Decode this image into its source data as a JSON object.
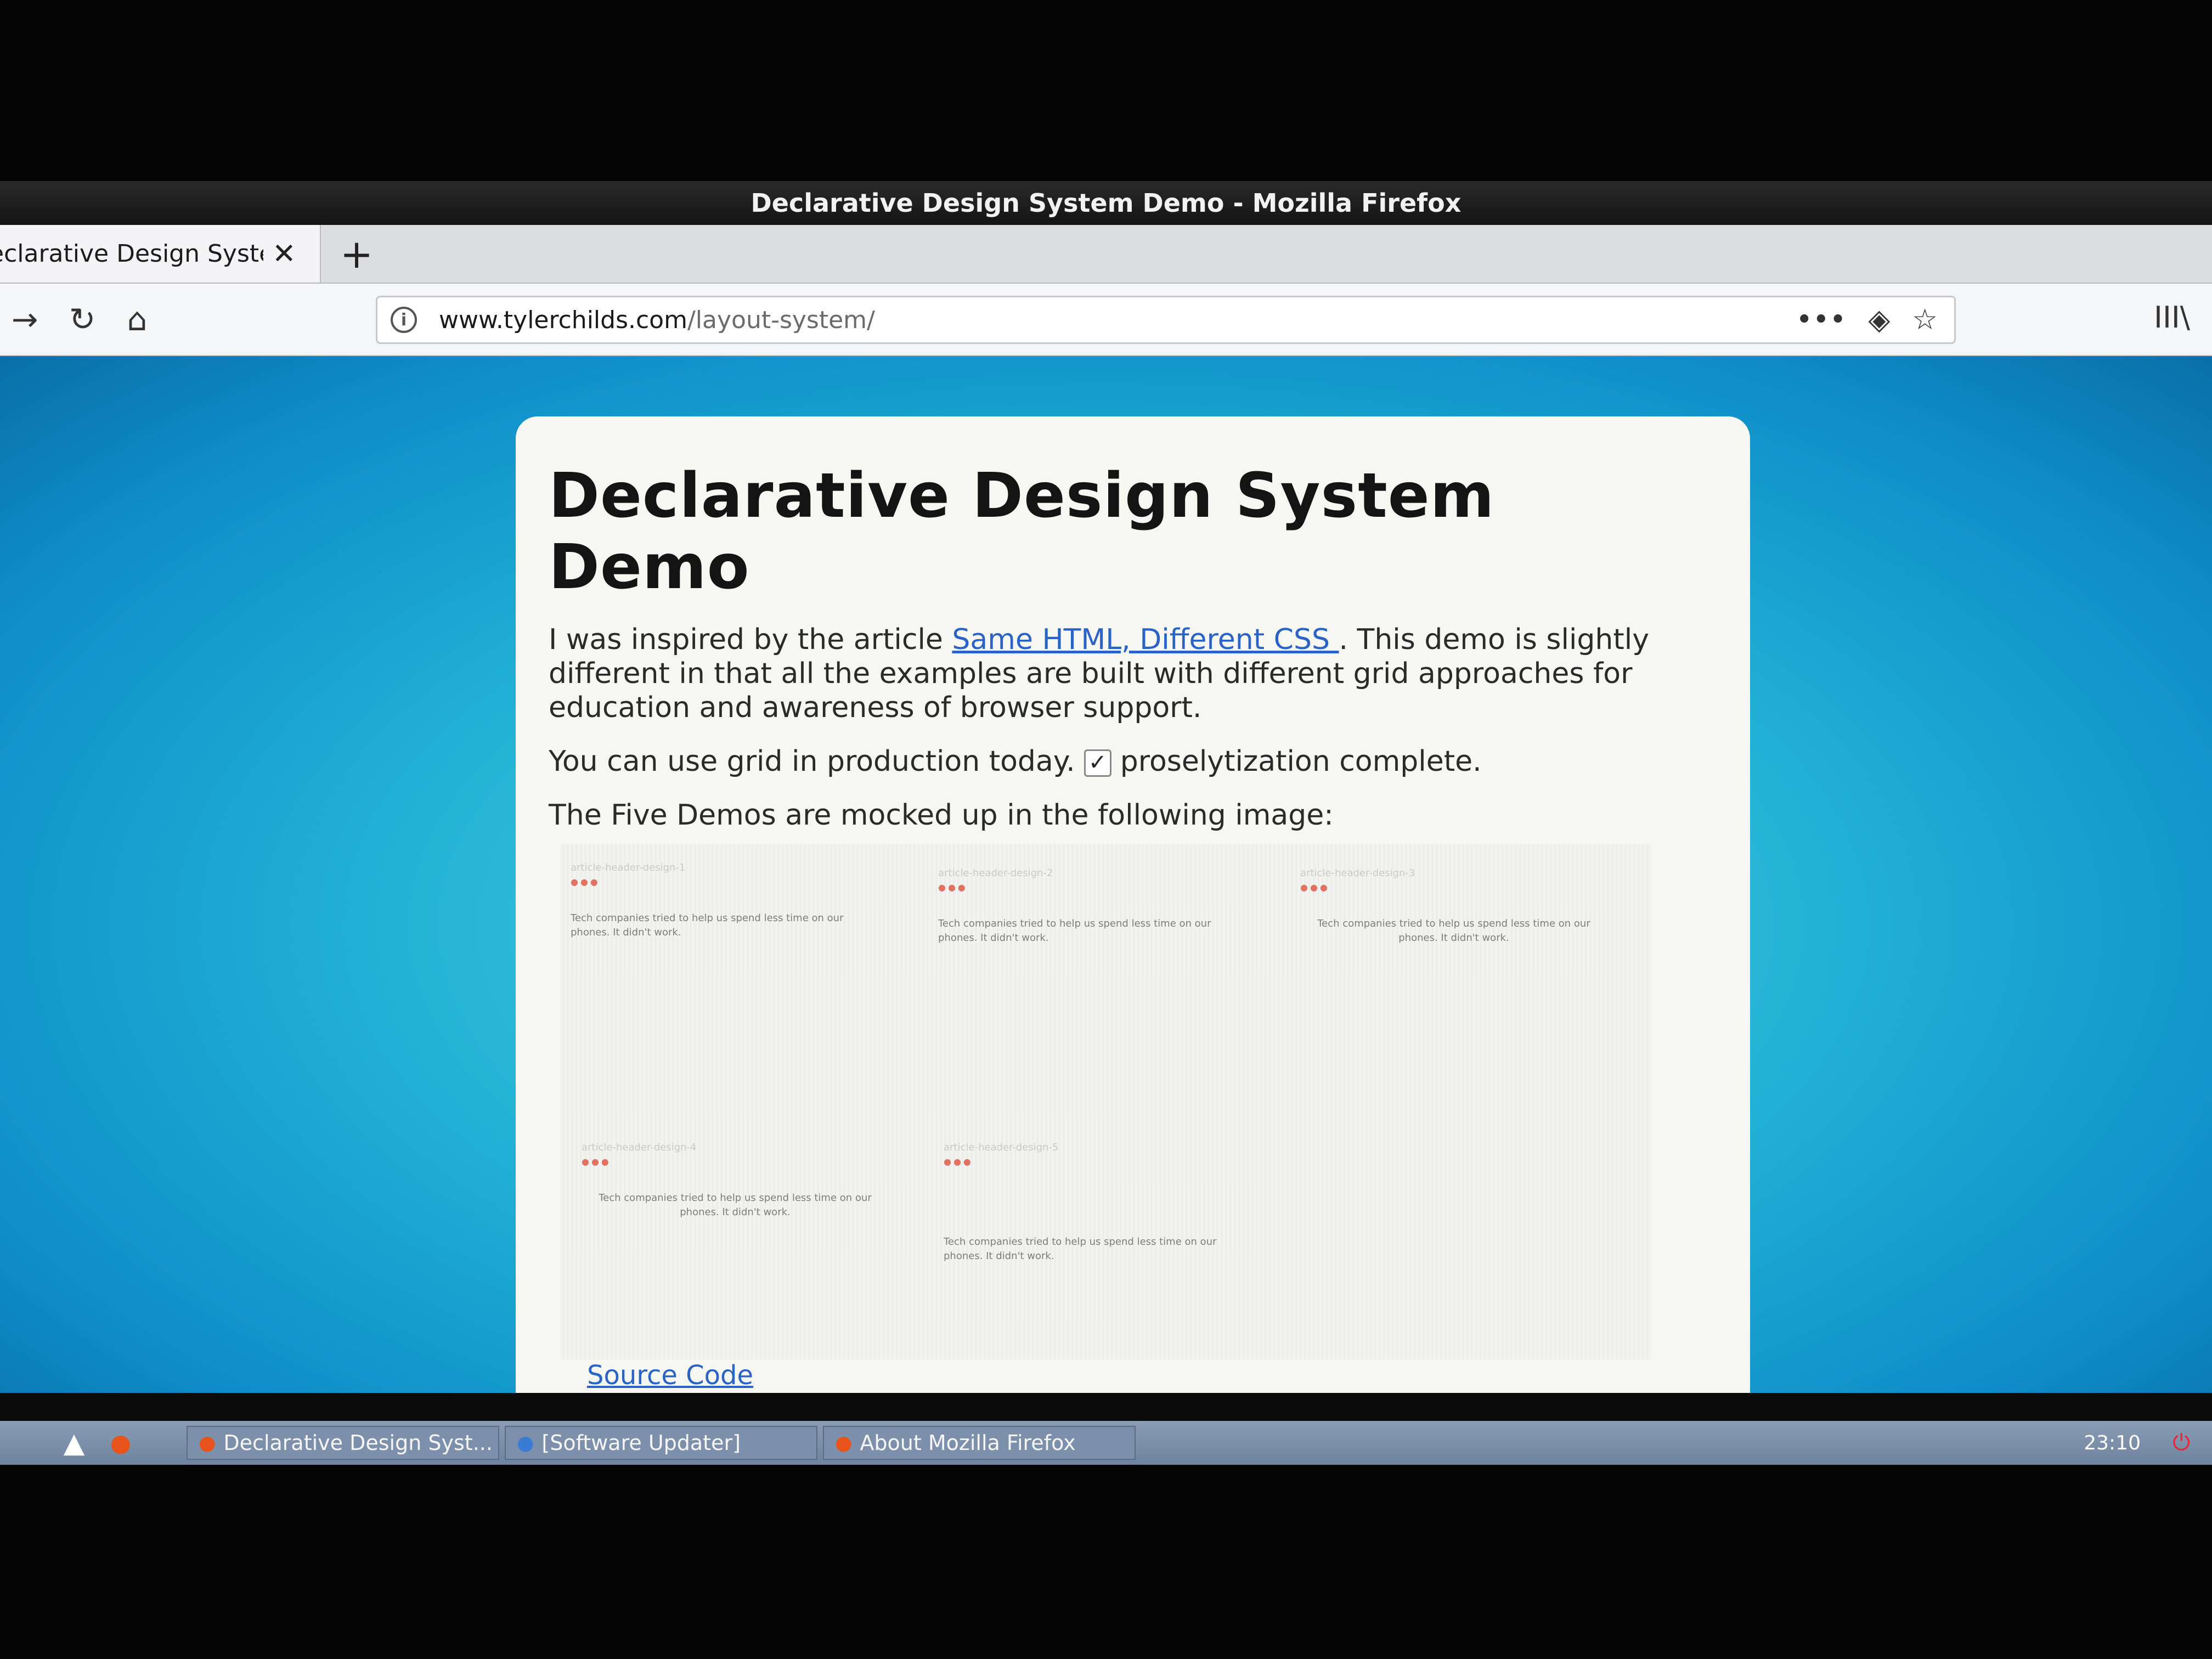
{
  "window": {
    "title": "Declarative Design System Demo - Mozilla Firefox"
  },
  "tabs": [
    {
      "label": "eclarative Design Syste",
      "close": "✕"
    }
  ],
  "newtab_label": "+",
  "nav": {
    "back_icon": "←",
    "forward_icon": "→",
    "reload_icon": "↻",
    "home_icon": "⌂",
    "url_host": "www.tylerchilds.com",
    "url_path": "/layout-system/",
    "more_icon": "•••",
    "pocket_icon": "◈",
    "bookmark_icon": "☆",
    "library_icon": "III\\"
  },
  "page": {
    "title": "Declarative Design System Demo",
    "intro_before": "I was inspired by the article ",
    "intro_link": "Same HTML, Different CSS ",
    "intro_after": ". This demo is slightly different in that all the examples are built with different grid approaches for education and awareness of browser support.",
    "grid_before": "You can use grid in production today.",
    "grid_check": "✓",
    "grid_after": "proselytization complete.",
    "demos_line": "The Five Demos are mocked up in the following image:",
    "source_link": "Source Code",
    "mock_cards": [
      {
        "title": "article-header-design-1",
        "body": "Tech companies tried to help us spend less time on our phones. It didn't work."
      },
      {
        "title": "article-header-design-2",
        "body": "Tech companies tried to help us spend less time on our phones. It didn't work."
      },
      {
        "title": "article-header-design-3",
        "body": "Tech companies tried to help us spend less time on our phones. It didn't work."
      },
      {
        "title": "article-header-design-4",
        "body": "Tech companies tried to help us spend less time on our phones. It didn't work."
      },
      {
        "title": "article-header-design-5",
        "body": "Tech companies tried to help us spend less time on our phones. It didn't work."
      }
    ]
  },
  "taskbar": {
    "items": [
      {
        "label": "Declarative Design Syst..."
      },
      {
        "label": "[Software Updater]"
      },
      {
        "label": "About Mozilla Firefox"
      }
    ],
    "clock": "23:10"
  }
}
